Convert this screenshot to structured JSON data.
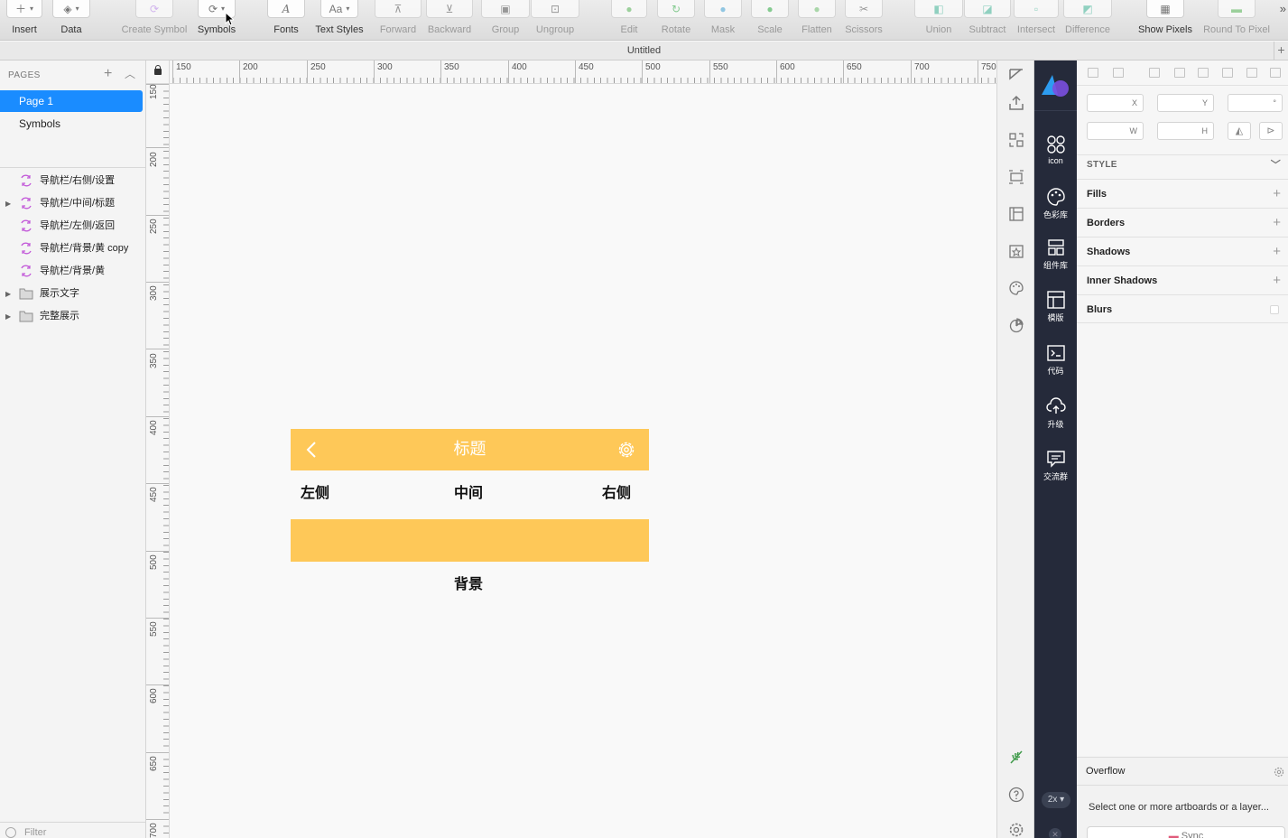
{
  "toolbar": {
    "items": [
      {
        "label": "Insert",
        "icon": "+"
      },
      {
        "label": "Data",
        "icon": "layers"
      },
      {
        "label": "Create Symbol",
        "icon": "symbol"
      },
      {
        "label": "Symbols",
        "icon": "symbol"
      },
      {
        "label": "Fonts",
        "icon": "A"
      },
      {
        "label": "Text Styles",
        "icon": "Aa"
      },
      {
        "label": "Forward",
        "icon": "forward"
      },
      {
        "label": "Backward",
        "icon": "backward"
      },
      {
        "label": "Group",
        "icon": "group"
      },
      {
        "label": "Ungroup",
        "icon": "ungroup"
      },
      {
        "label": "Edit",
        "icon": "edit"
      },
      {
        "label": "Rotate",
        "icon": "rotate"
      },
      {
        "label": "Mask",
        "icon": "mask"
      },
      {
        "label": "Scale",
        "icon": "scale"
      },
      {
        "label": "Flatten",
        "icon": "flatten"
      },
      {
        "label": "Scissors",
        "icon": "scissors"
      },
      {
        "label": "Union",
        "icon": "union"
      },
      {
        "label": "Subtract",
        "icon": "subtract"
      },
      {
        "label": "Intersect",
        "icon": "intersect"
      },
      {
        "label": "Difference",
        "icon": "difference"
      },
      {
        "label": "Show Pixels",
        "icon": "pixels"
      },
      {
        "label": "Round To Pixel",
        "icon": "round"
      }
    ]
  },
  "window": {
    "title": "Untitled"
  },
  "pages": {
    "header": "PAGES",
    "items": [
      {
        "label": "Page 1",
        "selected": true
      },
      {
        "label": "Symbols",
        "selected": false
      }
    ]
  },
  "layers": [
    {
      "name": "导航栏/右侧/设置",
      "type": "symbol",
      "expandable": false
    },
    {
      "name": "导航栏/中间/标题",
      "type": "symbol",
      "expandable": true
    },
    {
      "name": "导航栏/左侧/返回",
      "type": "symbol",
      "expandable": false
    },
    {
      "name": "导航栏/背景/黄 copy",
      "type": "symbol",
      "expandable": false
    },
    {
      "name": "导航栏/背景/黄",
      "type": "symbol",
      "expandable": false
    },
    {
      "name": "展示文字",
      "type": "folder",
      "expandable": true
    },
    {
      "name": "完整展示",
      "type": "folder",
      "expandable": true
    }
  ],
  "filter": {
    "placeholder": "Filter"
  },
  "rulers": {
    "top": [
      "150",
      "200",
      "250",
      "300",
      "350",
      "400",
      "450",
      "500",
      "550",
      "600",
      "650",
      "700",
      "750"
    ],
    "left": [
      "150",
      "200",
      "250",
      "300",
      "350",
      "400",
      "450",
      "500",
      "550",
      "600",
      "650",
      "700"
    ]
  },
  "canvas": {
    "nav_title": "标题",
    "label_left": "左侧",
    "label_middle": "中间",
    "label_right": "右侧",
    "label_background": "背景",
    "accent_color": "#fec858"
  },
  "plugin_bar": {
    "items": [
      {
        "label": "icon",
        "icon": "grid-icon"
      },
      {
        "label": "色彩库",
        "icon": "palette-icon"
      },
      {
        "label": "组件库",
        "icon": "components-icon"
      },
      {
        "label": "模版",
        "icon": "template-icon"
      },
      {
        "label": "代码",
        "icon": "terminal-icon"
      },
      {
        "label": "升级",
        "icon": "cloud-upload-icon"
      },
      {
        "label": "交流群",
        "icon": "chat-icon"
      }
    ],
    "zoom": "2x"
  },
  "inspector": {
    "fields": {
      "x": "X",
      "y": "Y",
      "rotation": "°",
      "w": "W",
      "h": "H"
    },
    "style_header": "STYLE",
    "sections": [
      {
        "label": "Fills",
        "control": "+"
      },
      {
        "label": "Borders",
        "control": "+"
      },
      {
        "label": "Shadows",
        "control": "+"
      },
      {
        "label": "Inner Shadows",
        "control": "+"
      },
      {
        "label": "Blurs",
        "control": "checkbox"
      }
    ],
    "overflow": {
      "title": "Overflow",
      "message": "Select one or more artboards or a layer...",
      "sync_label": "Sync"
    }
  }
}
